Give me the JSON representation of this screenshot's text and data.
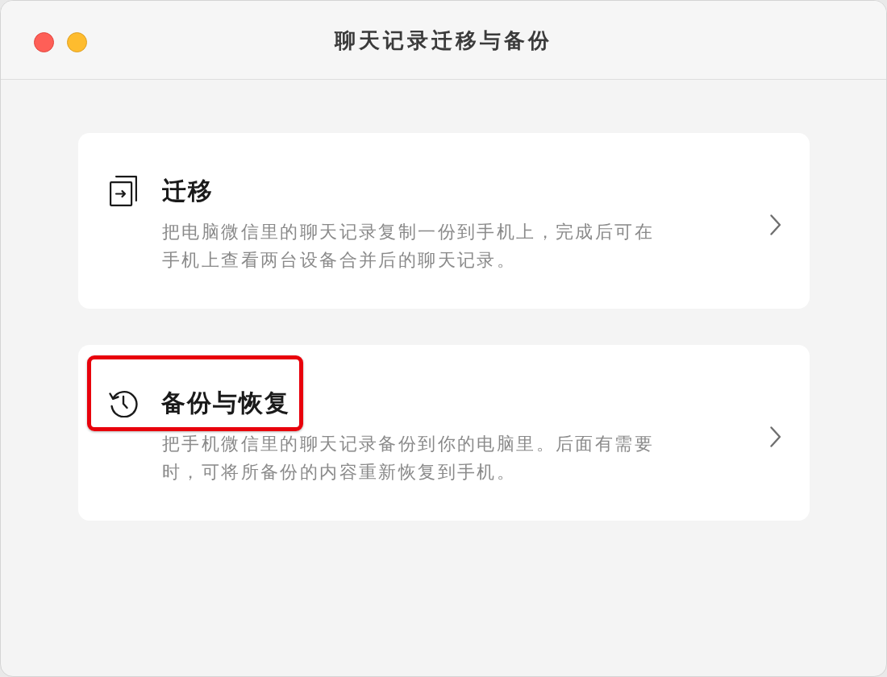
{
  "window": {
    "title": "聊天记录迁移与备份",
    "controls": [
      {
        "kind": "close"
      },
      {
        "kind": "minimize"
      }
    ]
  },
  "options": [
    {
      "kind": "migrate",
      "title": "迁移",
      "description": "把电脑微信里的聊天记录复制一份到手机上，完成后可在手机上查看两台设备合并后的聊天记录。",
      "highlighted": false
    },
    {
      "kind": "backup",
      "title": "备份与恢复",
      "description": "把手机微信里的聊天记录备份到你的电脑里。后面有需要时，可将所备份的内容重新恢复到手机。",
      "highlighted": true
    }
  ]
}
